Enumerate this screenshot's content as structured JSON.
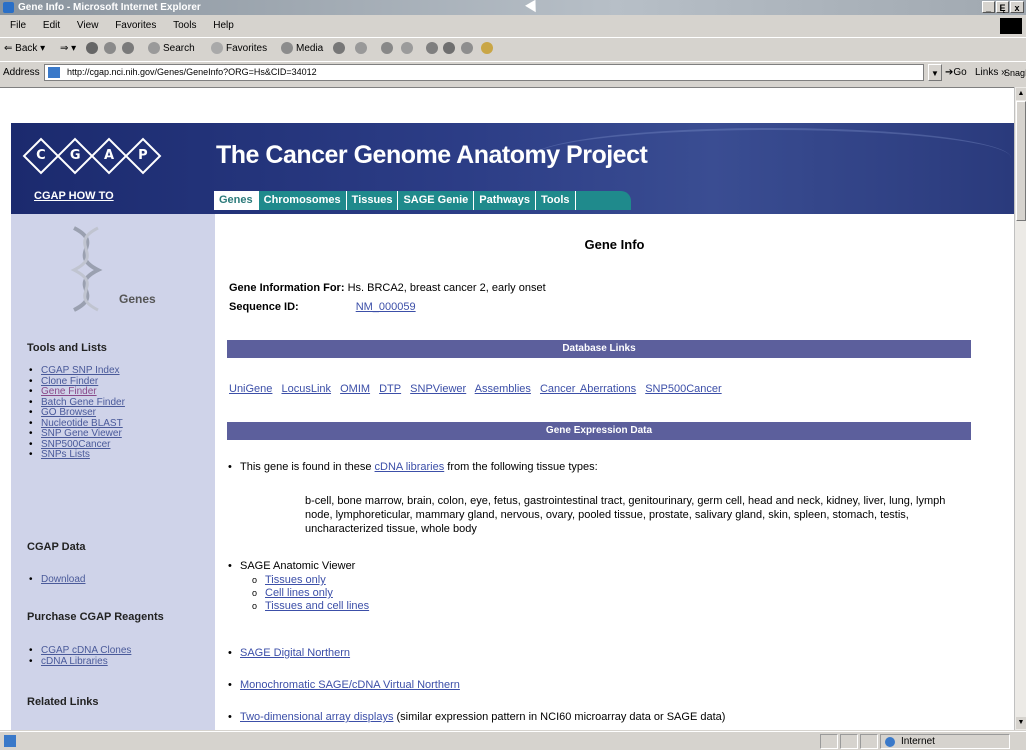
{
  "window": {
    "title": "Gene Info - Microsoft Internet Explorer",
    "controls": [
      "_",
      "Ę",
      "x"
    ]
  },
  "menu": [
    "File",
    "Edit",
    "View",
    "Favorites",
    "Tools",
    "Help"
  ],
  "toolbar": {
    "back": "Back",
    "search": "Search",
    "favorites": "Favorites",
    "media": "Media"
  },
  "address": {
    "label": "Address",
    "url": "http://cgap.nci.nih.gov/Genes/GeneInfo?ORG=Hs&CID=34012",
    "go": "Go",
    "links": "Links »",
    "snagit": "SnagIt"
  },
  "status": {
    "zone": "Internet"
  },
  "page": {
    "banner_title": "The Cancer Genome Anatomy Project",
    "logo_letters": [
      "C",
      "G",
      "A",
      "P"
    ],
    "howto": "CGAP HOW TO",
    "tabs": [
      "Genes",
      "Chromosomes",
      "Tissues",
      "SAGE Genie",
      "Pathways",
      "Tools"
    ],
    "sidebar": {
      "icon_label": "Genes",
      "tools_title": "Tools and Lists",
      "tools": [
        "CGAP SNP Index",
        "Clone Finder",
        "Gene Finder",
        "Batch Gene Finder",
        "GO Browser",
        "Nucleotide BLAST",
        "SNP Gene Viewer",
        "SNP500Cancer",
        "SNPs Lists"
      ],
      "data_title": "CGAP Data",
      "data": [
        "Download"
      ],
      "reagents_title": "Purchase CGAP Reagents",
      "reagents": [
        "CGAP cDNA Clones",
        "cDNA Libraries"
      ],
      "related_title": "Related Links"
    },
    "main": {
      "heading": "Gene Info",
      "gene_label": "Gene Information For:",
      "gene_value": "Hs. BRCA2, breast cancer 2, early onset",
      "seq_label": "Sequence ID:",
      "seq_value": "NM_000059",
      "db_bar": "Database Links",
      "db_links": [
        "UniGene",
        "LocusLink",
        "OMIM",
        "DTP",
        "SNPViewer",
        "Assemblies",
        "Cancer Aberrations",
        "SNP500Cancer"
      ],
      "expr_bar": "Gene Expression Data",
      "found_pre": "This gene is found in these",
      "found_link": "cDNA libraries",
      "found_post": "from the following tissue types:",
      "tissues": "b-cell, bone marrow, brain, colon, eye, fetus, gastrointestinal tract, genitourinary, germ cell, head and neck, kidney, liver, lung, lymph node, lymphoreticular, mammary gland, nervous, ovary, pooled tissue, prostate, salivary gland, skin, spleen, stomach, testis, uncharacterized tissue, whole body",
      "sage_viewer": "SAGE Anatomic Viewer",
      "sage_sub": [
        "Tissues only",
        "Cell lines only",
        "Tissues and cell lines"
      ],
      "sage_northern": "SAGE Digital Northern",
      "mono": "Monochromatic SAGE/cDNA Virtual Northern",
      "twod_link": "Two-dimensional array displays",
      "twod_post": "(similar expression pattern in NCI60 microarray data or SAGE data)"
    }
  }
}
